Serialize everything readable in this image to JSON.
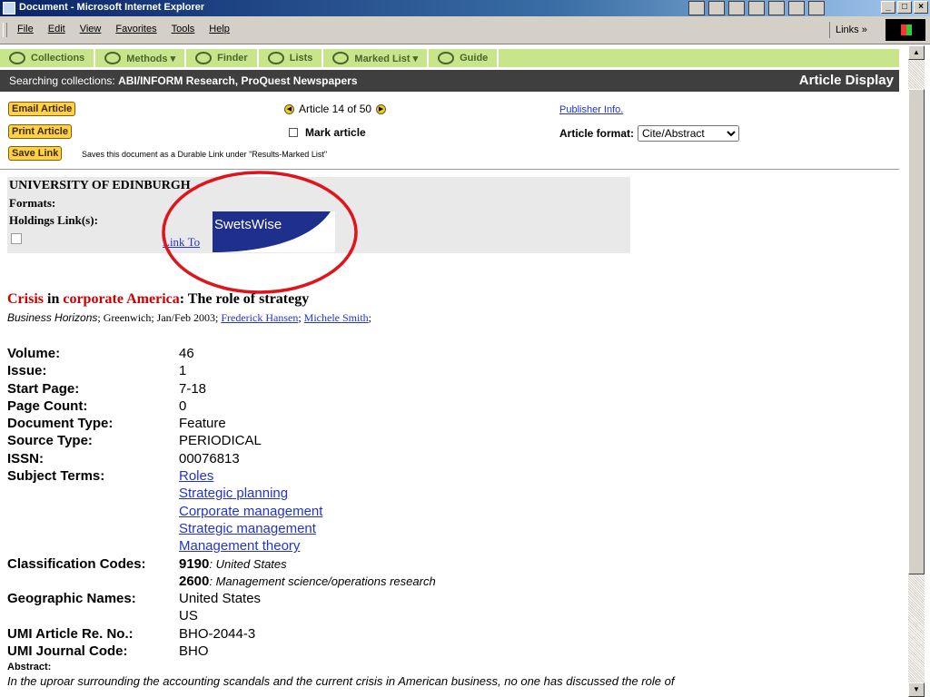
{
  "window": {
    "title": "Document - Microsoft Internet Explorer"
  },
  "menu": {
    "items": [
      "File",
      "Edit",
      "View",
      "Favorites",
      "Tools",
      "Help"
    ],
    "links": "Links »"
  },
  "nav": {
    "tabs": [
      "Collections",
      "Methods ▾",
      "Finder",
      "Lists",
      "Marked List ▾",
      "Guide"
    ]
  },
  "search": {
    "label": "Searching collections:",
    "databases": "ABI/INFORM Research, ProQuest Newspapers",
    "mode": "Article Display"
  },
  "actions": {
    "email": "Email Article",
    "print": "Print Article",
    "save": "Save Link",
    "save_note": "Saves this document as a Durable Link under \"Results-Marked List\""
  },
  "paging": {
    "text": "Article 14 of 50"
  },
  "mark": {
    "label": "Mark article"
  },
  "publisher_link": "Publisher Info.",
  "format": {
    "label": "Article format:",
    "selected": "Cite/Abstract"
  },
  "holdings": {
    "institution": "UNIVERSITY OF EDINBURGH",
    "formats_label": "Formats:",
    "holdings_label": "Holdings Link(s):",
    "link_text": "Link To",
    "badge": "SwetsWise"
  },
  "article": {
    "title_word1": "Crisis",
    "title_in": " in ",
    "title_word2": "corporate",
    "title_word3": " America",
    "title_rest": ": The role of strategy",
    "publication": "Business Horizons",
    "place_date": "; Greenwich; Jan/Feb 2003; ",
    "author1": "Frederick Hansen",
    "sep": "; ",
    "author2": "Michele Smith",
    "end": ";"
  },
  "fields": {
    "volume_k": "Volume:",
    "volume_v": "46",
    "issue_k": "Issue:",
    "issue_v": "1",
    "start_k": "Start Page:",
    "start_v": "7-18",
    "pagecount_k": "Page Count:",
    "pagecount_v": "0",
    "doctype_k": "Document Type:",
    "doctype_v": "Feature",
    "srctype_k": "Source Type:",
    "srctype_v": "PERIODICAL",
    "issn_k": "ISSN:",
    "issn_v": "00076813",
    "subject_k": "Subject Terms:",
    "subjects": [
      "Roles",
      "Strategic planning",
      "Corporate management",
      "Strategic management",
      "Management theory"
    ],
    "class_k": "Classification Codes:",
    "class1_code": "9190",
    "class1_desc": ": United States",
    "class2_code": "2600",
    "class2_desc": ": Management science/operations research",
    "geo_k": "Geographic Names:",
    "geo1": "United States",
    "geo2": "US",
    "umi_art_k": "UMI Article Re. No.:",
    "umi_art_v": "BHO-2044-3",
    "umi_j_k": "UMI Journal Code:",
    "umi_j_v": "BHO"
  },
  "abstract": {
    "label": "Abstract:",
    "text": "In the uproar surrounding the accounting scandals and the current crisis in American business, no one has discussed the role of"
  },
  "colors": {
    "nav_bg": "#c7e58a",
    "search_bg": "#3f3f3f",
    "button_bg": "#ffd147",
    "hit_red": "#cc0000",
    "link_blue": "#2233cc"
  }
}
